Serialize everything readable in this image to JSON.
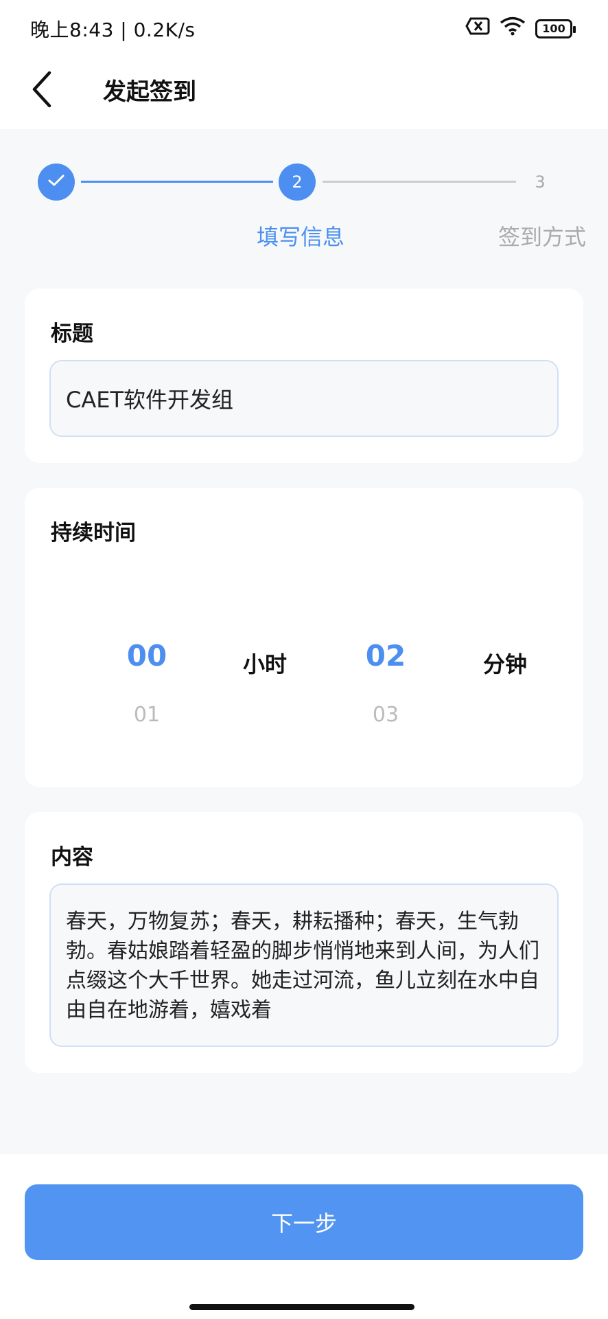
{
  "theme": {
    "accent": "#4d8ff0",
    "button_color": "#5194f1",
    "inactive_line": "#cccccc",
    "inactive_text": "#aaaaaa"
  },
  "status_bar": {
    "time_speed": "晚上8:43 | 0.2K/s",
    "battery": "100",
    "icons": [
      "sim-off-icon",
      "wifi-icon",
      "battery-icon"
    ]
  },
  "header": {
    "back_icon": "chevron-left-icon",
    "title": "发起签到"
  },
  "steps": {
    "items": [
      {
        "number": "",
        "label": "",
        "state": "done"
      },
      {
        "number": "2",
        "label": "填写信息",
        "state": "active"
      },
      {
        "number": "3",
        "label": "签到方式",
        "state": "pending"
      }
    ]
  },
  "form": {
    "title_section": {
      "label": "标题",
      "value": "CAET软件开发组"
    },
    "duration_section": {
      "label": "持续时间",
      "hours": {
        "selected": "00",
        "next": "01",
        "unit": "小时"
      },
      "minutes": {
        "selected": "02",
        "next": "03",
        "unit": "分钟"
      }
    },
    "content_section": {
      "label": "内容",
      "value": "春天，万物复苏；春天，耕耘播种；春天，生气勃勃。春姑娘踏着轻盈的脚步悄悄地来到人间，为人们点缀这个大千世界。她走过河流，鱼儿立刻在水中自由自在地游着，嬉戏着"
    }
  },
  "footer": {
    "next_label": "下一步"
  }
}
